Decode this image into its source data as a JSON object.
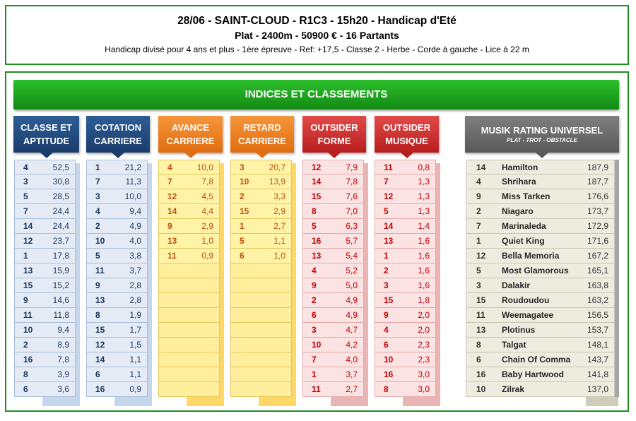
{
  "header": {
    "line1": "28/06 - SAINT-CLOUD - R1C3 - 15h20 - Handicap d'Eté",
    "line2": "Plat - 2400m - 50900 € - 16 Partants",
    "line3": "Handicap divisé pour 4 ans et plus - 1ère épreuve - Ref: +17,5 - Classe 2 - Herbe - Corde à gauche - Lice à 22 m"
  },
  "banner": "INDICES ET CLASSEMENTS",
  "columns": [
    {
      "title1": "CLASSE ET",
      "title2": "APTITUDE",
      "color": "#1a3c6a",
      "rows": [
        [
          "4",
          "52,5"
        ],
        [
          "3",
          "30,8"
        ],
        [
          "5",
          "28,5"
        ],
        [
          "7",
          "24,4"
        ],
        [
          "14",
          "24,4"
        ],
        [
          "12",
          "23,7"
        ],
        [
          "1",
          "17,8"
        ],
        [
          "13",
          "15,9"
        ],
        [
          "15",
          "15,2"
        ],
        [
          "9",
          "14,6"
        ],
        [
          "11",
          "11,8"
        ],
        [
          "10",
          "9,4"
        ],
        [
          "2",
          "8,9"
        ],
        [
          "16",
          "7,8"
        ],
        [
          "8",
          "3,9"
        ],
        [
          "6",
          "3,6"
        ]
      ]
    },
    {
      "title1": "COTATION",
      "title2": "CARRIERE",
      "color": "#1a3c6a",
      "rows": [
        [
          "1",
          "21,2"
        ],
        [
          "7",
          "11,3"
        ],
        [
          "3",
          "10,0"
        ],
        [
          "4",
          "9,4"
        ],
        [
          "2",
          "4,9"
        ],
        [
          "10",
          "4,0"
        ],
        [
          "5",
          "3,8"
        ],
        [
          "11",
          "3,7"
        ],
        [
          "9",
          "2,8"
        ],
        [
          "13",
          "2,8"
        ],
        [
          "8",
          "1,9"
        ],
        [
          "15",
          "1,7"
        ],
        [
          "12",
          "1,5"
        ],
        [
          "14",
          "1,1"
        ],
        [
          "6",
          "1,1"
        ],
        [
          "16",
          "0,9"
        ]
      ]
    },
    {
      "title1": "AVANCE",
      "title2": "CARRIERE",
      "color": "#e06d10",
      "rows": [
        [
          "4",
          "10,0"
        ],
        [
          "7",
          "7,8"
        ],
        [
          "12",
          "4,5"
        ],
        [
          "14",
          "4,4"
        ],
        [
          "9",
          "2,9"
        ],
        [
          "13",
          "1,0"
        ],
        [
          "11",
          "0,9"
        ],
        [
          "",
          ""
        ],
        [
          "",
          ""
        ],
        [
          "",
          ""
        ],
        [
          "",
          ""
        ],
        [
          "",
          ""
        ],
        [
          "",
          ""
        ],
        [
          "",
          ""
        ],
        [
          "",
          ""
        ],
        [
          "",
          ""
        ]
      ]
    },
    {
      "title1": "RETARD",
      "title2": "CARRIERE",
      "color": "#e06d10",
      "rows": [
        [
          "3",
          "20,7"
        ],
        [
          "10",
          "13,9"
        ],
        [
          "2",
          "3,3"
        ],
        [
          "15",
          "2,9"
        ],
        [
          "1",
          "2,7"
        ],
        [
          "5",
          "1,1"
        ],
        [
          "6",
          "1,0"
        ],
        [
          "",
          ""
        ],
        [
          "",
          ""
        ],
        [
          "",
          ""
        ],
        [
          "",
          ""
        ],
        [
          "",
          ""
        ],
        [
          "",
          ""
        ],
        [
          "",
          ""
        ],
        [
          "",
          ""
        ],
        [
          "",
          ""
        ]
      ]
    },
    {
      "title1": "OUTSIDER",
      "title2": "FORME",
      "color": "#b81e1e",
      "rows": [
        [
          "12",
          "7,9"
        ],
        [
          "14",
          "7,8"
        ],
        [
          "15",
          "7,6"
        ],
        [
          "8",
          "7,0"
        ],
        [
          "5",
          "6,3"
        ],
        [
          "16",
          "5,7"
        ],
        [
          "13",
          "5,4"
        ],
        [
          "4",
          "5,2"
        ],
        [
          "9",
          "5,0"
        ],
        [
          "2",
          "4,9"
        ],
        [
          "6",
          "4,9"
        ],
        [
          "3",
          "4,7"
        ],
        [
          "10",
          "4,2"
        ],
        [
          "7",
          "4,0"
        ],
        [
          "1",
          "3,7"
        ],
        [
          "11",
          "2,7"
        ]
      ]
    },
    {
      "title1": "OUTSIDER",
      "title2": "MUSIQUE",
      "color": "#b81e1e",
      "rows": [
        [
          "11",
          "0,8"
        ],
        [
          "7",
          "1,3"
        ],
        [
          "12",
          "1,3"
        ],
        [
          "5",
          "1,3"
        ],
        [
          "14",
          "1,4"
        ],
        [
          "13",
          "1,6"
        ],
        [
          "1",
          "1,6"
        ],
        [
          "2",
          "1,6"
        ],
        [
          "3",
          "1,6"
        ],
        [
          "15",
          "1,8"
        ],
        [
          "9",
          "2,0"
        ],
        [
          "4",
          "2,0"
        ],
        [
          "6",
          "2,3"
        ],
        [
          "10",
          "2,3"
        ],
        [
          "16",
          "3,0"
        ],
        [
          "8",
          "3,0"
        ]
      ]
    }
  ],
  "musik": {
    "title": "MUSIK RATING UNIVERSEL",
    "subtitle": "PLAT - TROT - OBSTACLE",
    "rows": [
      [
        "14",
        "Hamilton",
        "187,9"
      ],
      [
        "4",
        "Shrihara",
        "187,7"
      ],
      [
        "9",
        "Miss Tarken",
        "176,6"
      ],
      [
        "2",
        "Niagaro",
        "173,7"
      ],
      [
        "7",
        "Marinaleda",
        "172,9"
      ],
      [
        "1",
        "Quiet King",
        "171,6"
      ],
      [
        "12",
        "Bella Memoria",
        "167,2"
      ],
      [
        "5",
        "Most Glamorous",
        "165,1"
      ],
      [
        "3",
        "Dalakir",
        "163,8"
      ],
      [
        "15",
        "Roudoudou",
        "163,2"
      ],
      [
        "11",
        "Weemagatee",
        "156,5"
      ],
      [
        "13",
        "Plotinus",
        "153,7"
      ],
      [
        "8",
        "Talgat",
        "148,1"
      ],
      [
        "6",
        "Chain Of Comma",
        "143,7"
      ],
      [
        "16",
        "Baby Hartwood",
        "141,8"
      ],
      [
        "10",
        "Zilrak",
        "137,0"
      ]
    ]
  }
}
